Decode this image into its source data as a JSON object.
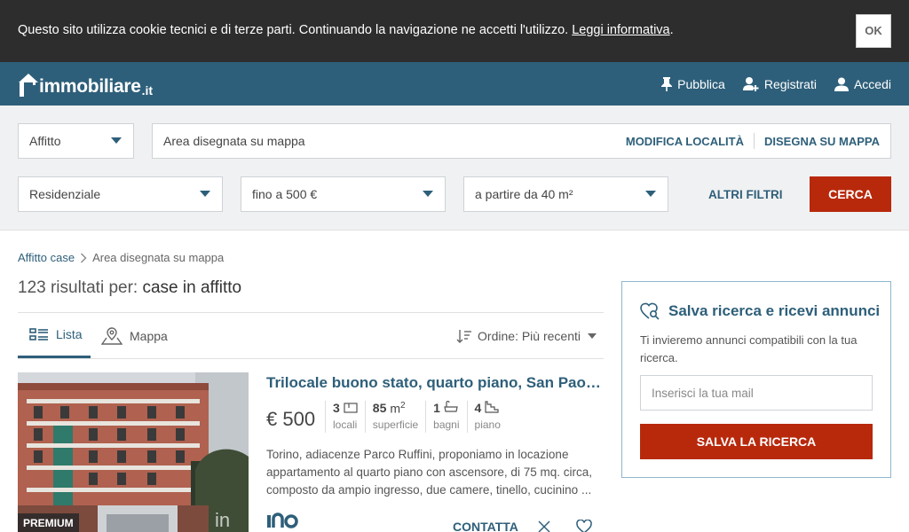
{
  "cookie": {
    "text": "Questo sito utilizza cookie tecnici e di terze parti. Continuando la navigazione ne accetti l'utilizzo.",
    "link": "Leggi informativa",
    "after": ".",
    "ok": "OK"
  },
  "header": {
    "logo_main": "immobiliare",
    "logo_tld": ".it",
    "nav": [
      {
        "label": "Pubblica",
        "icon": "pin-icon"
      },
      {
        "label": "Registrati",
        "icon": "add-user-icon"
      },
      {
        "label": "Accedi",
        "icon": "user-icon"
      }
    ]
  },
  "search": {
    "contract": "Affitto",
    "area": "Area disegnata su mappa",
    "modify_location": "MODIFICA LOCALITÀ",
    "draw_map": "DISEGNA SU MAPPA",
    "category": "Residenziale",
    "price": "fino a 500 €",
    "surface": "a partire da 40 m²",
    "more_filters": "ALTRI FILTRI",
    "search_button": "CERCA"
  },
  "breadcrumb": {
    "root": "Affitto case",
    "current": "Area disegnata su mappa"
  },
  "results": {
    "count_label": "123 risultati per:",
    "query": "case in affitto"
  },
  "tabs": {
    "list": "Lista",
    "map": "Mappa",
    "order": "Ordine: Più recenti"
  },
  "listing": {
    "badge": "PREMIUM",
    "title": "Trilocale buono stato, quarto piano, San Paolo, Torino",
    "price": "€ 500",
    "features": [
      {
        "value": "3",
        "unit": "",
        "label": "locali",
        "icon": "rooms-icon"
      },
      {
        "value": "85",
        "unit": "m",
        "label": "superficie",
        "icon": ""
      },
      {
        "value": "1",
        "unit": "",
        "label": "bagni",
        "icon": "bath-icon"
      },
      {
        "value": "4",
        "unit": "",
        "label": "piano",
        "icon": "stairs-icon"
      }
    ],
    "surface_exp": "2",
    "description": "Torino, adiacenze Parco Ruffini, proponiamo in locazione appartamento al quarto piano con ascensore, di 75 mq. circa, composto da ampio ingresso, due camere, tinello, cucinino ...",
    "contact": "CONTATTA"
  },
  "save_search": {
    "title": "Salva ricerca e ricevi annunci",
    "subtitle": "Ti invieremo annunci compatibili con la tua ricerca.",
    "email_placeholder": "Inserisci la tua mail",
    "button": "SALVA LA RICERCA"
  },
  "colors": {
    "brand": "#2e5f7a",
    "accent": "#b8290c",
    "cookie_bg": "#2d2d2d"
  }
}
